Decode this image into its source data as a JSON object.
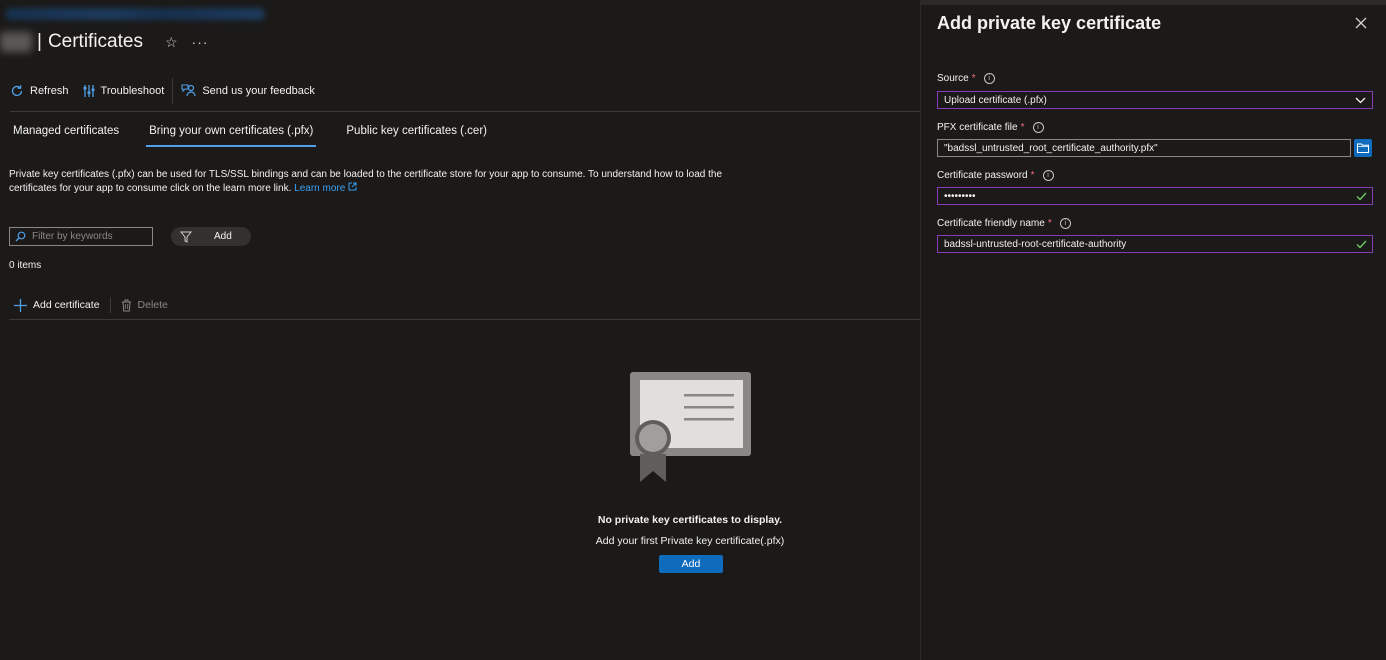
{
  "header": {
    "title_separator": "|",
    "title": "Certificates",
    "star_icon": "star-icon",
    "more_label": "···"
  },
  "toolbar": {
    "refresh_label": "Refresh",
    "troubleshoot_label": "Troubleshoot",
    "feedback_label": "Send us your feedback"
  },
  "tabs": [
    {
      "label": "Managed certificates",
      "active": false
    },
    {
      "label": "Bring your own certificates (.pfx)",
      "active": true
    },
    {
      "label": "Public key certificates (.cer)",
      "active": false
    }
  ],
  "description": {
    "text": "Private key certificates (.pfx) can be used for TLS/SSL bindings and can be loaded to the certificate store for your app to consume. To understand how to load the certificates for your app to consume click on the learn more link.",
    "link_label": "Learn more"
  },
  "filter": {
    "placeholder": "Filter by keywords",
    "add_label": "Add"
  },
  "items_count": "0 items",
  "commands": {
    "add_certificate_label": "Add certificate",
    "delete_label": "Delete"
  },
  "empty_state": {
    "title": "No private key certificates to display.",
    "subtitle": "Add your first Private key certificate(.pfx)",
    "button_label": "Add"
  },
  "panel": {
    "title": "Add private key certificate",
    "source": {
      "label": "Source",
      "required_mark": "*",
      "value": "Upload certificate (.pfx)"
    },
    "pfx_file": {
      "label": "PFX certificate file",
      "required_mark": "*",
      "value": "\"badssl_untrusted_root_certificate_authority.pfx\""
    },
    "password": {
      "label": "Certificate password",
      "required_mark": "*",
      "value": "•••••••••"
    },
    "friendly_name": {
      "label": "Certificate friendly name",
      "required_mark": "*",
      "value": "badssl-untrusted-root-certificate-authority"
    }
  },
  "colors": {
    "background": "#1b1a19",
    "accent": "#0f6cbd",
    "link": "#3aa0f3",
    "field_border_focus": "#8a3ab9",
    "valid_check": "#6ccb5f",
    "required": "#f1707b"
  }
}
